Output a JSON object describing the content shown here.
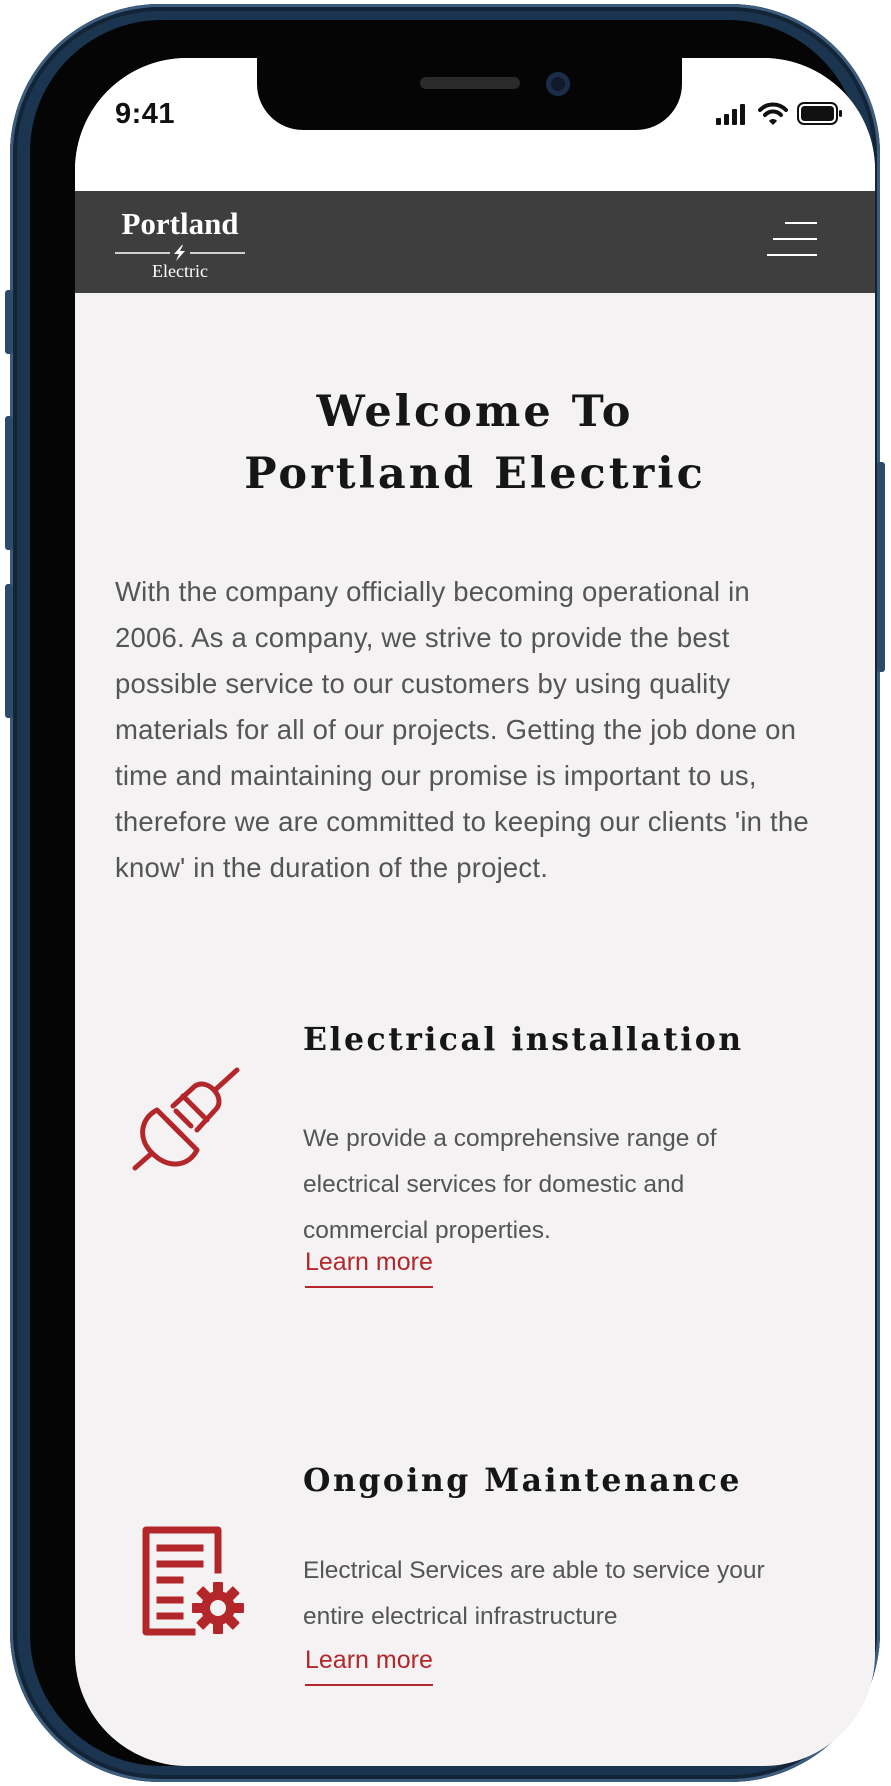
{
  "status_bar": {
    "time": "9:41"
  },
  "brand": {
    "line1": "Portland",
    "line2": "Electric"
  },
  "hero": {
    "title_line1": "Welcome To",
    "title_line2": "Portland Electric"
  },
  "intro": "With the company officially becoming operational in 2006. As a company, we strive to provide the best possible service to our customers by using quality materials for all of our projects. Getting the job done on time and maintaining our promise is important to us, therefore we are committed to keeping our clients 'in the know' in the duration of the project.",
  "services": [
    {
      "icon": "plug-icon",
      "title": "Electrical installation",
      "description": "We provide a comprehensive range of electrical services for domestic and commercial properties.",
      "link": "Learn more"
    },
    {
      "icon": "document-gear-icon",
      "title": "Ongoing Maintenance",
      "description": "Electrical Services are able to service your entire electrical infrastructure",
      "link": "Learn more"
    }
  ],
  "colors": {
    "accent": "#b3272b",
    "header_bg": "#3e3e3e",
    "page_bg": "#f4f2f3",
    "frame": "#1b3550"
  }
}
